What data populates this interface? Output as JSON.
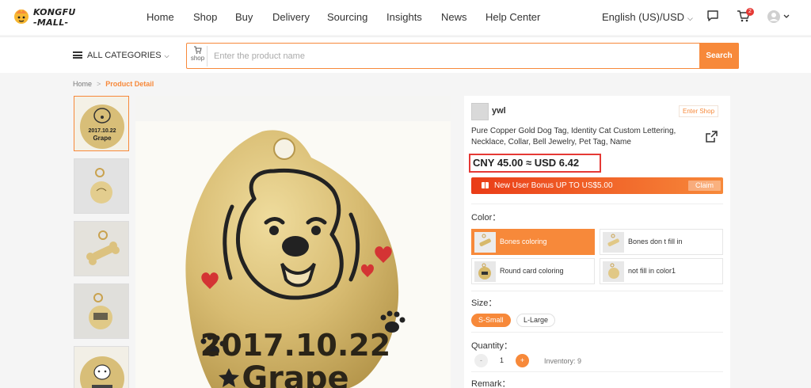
{
  "brand": {
    "line1": "KONGFU",
    "line2": "-MALL-"
  },
  "nav": {
    "links": [
      "Home",
      "Shop",
      "Buy",
      "Delivery",
      "Sourcing",
      "Insights",
      "News",
      "Help Center"
    ],
    "language": "English (US)/USD",
    "cart_count": "2"
  },
  "search": {
    "categories_label": "ALL CATEGORIES",
    "shop_tag": "shop",
    "placeholder": "Enter the product name",
    "button_label": "Search"
  },
  "breadcrumb": {
    "home": "Home",
    "current": "Product Detail"
  },
  "product": {
    "seller": "ywl",
    "enter_shop": "Enter Shop",
    "title": "Pure Copper Gold Dog Tag, Identity Cat Custom Lettering, Necklace, Collar, Bell Jewelry, Pet Tag, Name",
    "price": "CNY 45.00 ≈  USD 6.42",
    "bonus_text": "New User Bonus UP TO US$5.00",
    "claim_label": "Claim",
    "color_label": "Color：",
    "colors": [
      "Bones coloring",
      "Bones don t fill in",
      "Round card coloring",
      "not fill in color1"
    ],
    "selected_color": "Bones coloring",
    "size_label": "Size：",
    "sizes": [
      "S-Small",
      "L-Large"
    ],
    "selected_size": "S-Small",
    "quantity_label": "Quantity：",
    "quantity": "1",
    "qty_minus": "-",
    "qty_plus": "+",
    "inventory": "Inventory: 9",
    "remark_label": "Remark：",
    "tag_engraving": {
      "date": "2017.10.22",
      "name": "Grape"
    }
  },
  "colors": {
    "accent": "#f7893a",
    "price_border": "#e53935",
    "bonus_start": "#ea3c17"
  },
  "icons": [
    "hamburger-icon",
    "chevron-down-icon",
    "chat-icon",
    "cart-icon",
    "user-icon",
    "shop-cart-icon",
    "share-icon",
    "gift-icon"
  ]
}
